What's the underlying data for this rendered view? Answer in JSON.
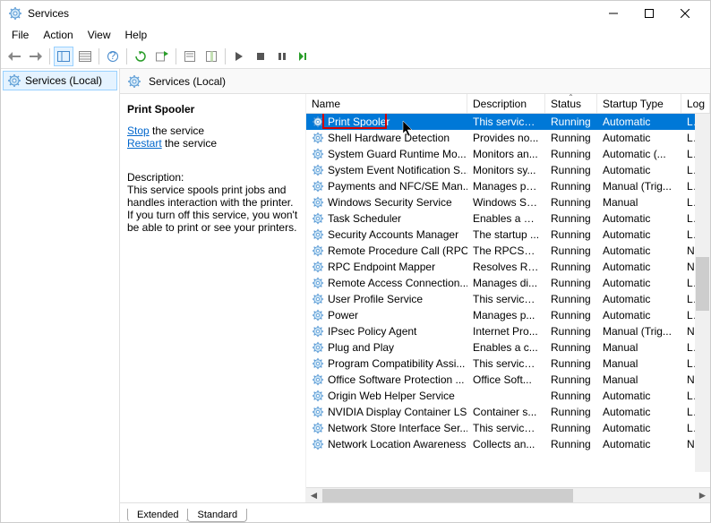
{
  "window": {
    "title": "Services"
  },
  "menu": {
    "items": [
      "File",
      "Action",
      "View",
      "Help"
    ]
  },
  "tree": {
    "item": "Services (Local)"
  },
  "content_header": "Services (Local)",
  "detail": {
    "selected_name": "Print Spooler",
    "stop_link": "Stop",
    "stop_suffix": " the service",
    "restart_link": "Restart",
    "restart_suffix": " the service",
    "desc_label": "Description:",
    "description": "This service spools print jobs and handles interaction with the printer. If you turn off this service, you won't be able to print or see your printers."
  },
  "columns": {
    "name": "Name",
    "description": "Description",
    "status": "Status",
    "startup": "Startup Type",
    "logon": "Log"
  },
  "services": [
    {
      "name": "Print Spooler",
      "desc": "This service ...",
      "status": "Running",
      "startup": "Automatic",
      "logon": "Loca",
      "selected": true
    },
    {
      "name": "Shell Hardware Detection",
      "desc": "Provides no...",
      "status": "Running",
      "startup": "Automatic",
      "logon": "Loca"
    },
    {
      "name": "System Guard Runtime Mo...",
      "desc": "Monitors an...",
      "status": "Running",
      "startup": "Automatic (...",
      "logon": "Loca"
    },
    {
      "name": "System Event Notification S...",
      "desc": "Monitors sy...",
      "status": "Running",
      "startup": "Automatic",
      "logon": "Loca"
    },
    {
      "name": "Payments and NFC/SE Man...",
      "desc": "Manages pa...",
      "status": "Running",
      "startup": "Manual (Trig...",
      "logon": "Loca"
    },
    {
      "name": "Windows Security Service",
      "desc": "Windows Se...",
      "status": "Running",
      "startup": "Manual",
      "logon": "Loca"
    },
    {
      "name": "Task Scheduler",
      "desc": "Enables a us...",
      "status": "Running",
      "startup": "Automatic",
      "logon": "Loca"
    },
    {
      "name": "Security Accounts Manager",
      "desc": "The startup ...",
      "status": "Running",
      "startup": "Automatic",
      "logon": "Loca"
    },
    {
      "name": "Remote Procedure Call (RPC)",
      "desc": "The RPCSS s...",
      "status": "Running",
      "startup": "Automatic",
      "logon": "Netv"
    },
    {
      "name": "RPC Endpoint Mapper",
      "desc": "Resolves RP...",
      "status": "Running",
      "startup": "Automatic",
      "logon": "Netv"
    },
    {
      "name": "Remote Access Connection...",
      "desc": "Manages di...",
      "status": "Running",
      "startup": "Automatic",
      "logon": "Loca"
    },
    {
      "name": "User Profile Service",
      "desc": "This service ...",
      "status": "Running",
      "startup": "Automatic",
      "logon": "Loca"
    },
    {
      "name": "Power",
      "desc": "Manages p...",
      "status": "Running",
      "startup": "Automatic",
      "logon": "Loca"
    },
    {
      "name": "IPsec Policy Agent",
      "desc": "Internet Pro...",
      "status": "Running",
      "startup": "Manual (Trig...",
      "logon": "Netv"
    },
    {
      "name": "Plug and Play",
      "desc": "Enables a c...",
      "status": "Running",
      "startup": "Manual",
      "logon": "Loca"
    },
    {
      "name": "Program Compatibility Assi...",
      "desc": "This service ...",
      "status": "Running",
      "startup": "Manual",
      "logon": "Loca"
    },
    {
      "name": "Office Software Protection ...",
      "desc": "Office Soft...",
      "status": "Running",
      "startup": "Manual",
      "logon": "Netv"
    },
    {
      "name": "Origin Web Helper Service",
      "desc": "",
      "status": "Running",
      "startup": "Automatic",
      "logon": "Loca"
    },
    {
      "name": "NVIDIA Display Container LS",
      "desc": "Container s...",
      "status": "Running",
      "startup": "Automatic",
      "logon": "Loca"
    },
    {
      "name": "Network Store Interface Ser...",
      "desc": "This service ...",
      "status": "Running",
      "startup": "Automatic",
      "logon": "Loca"
    },
    {
      "name": "Network Location Awareness",
      "desc": "Collects an...",
      "status": "Running",
      "startup": "Automatic",
      "logon": "Netv"
    }
  ],
  "tabs": {
    "extended": "Extended",
    "standard": "Standard"
  }
}
